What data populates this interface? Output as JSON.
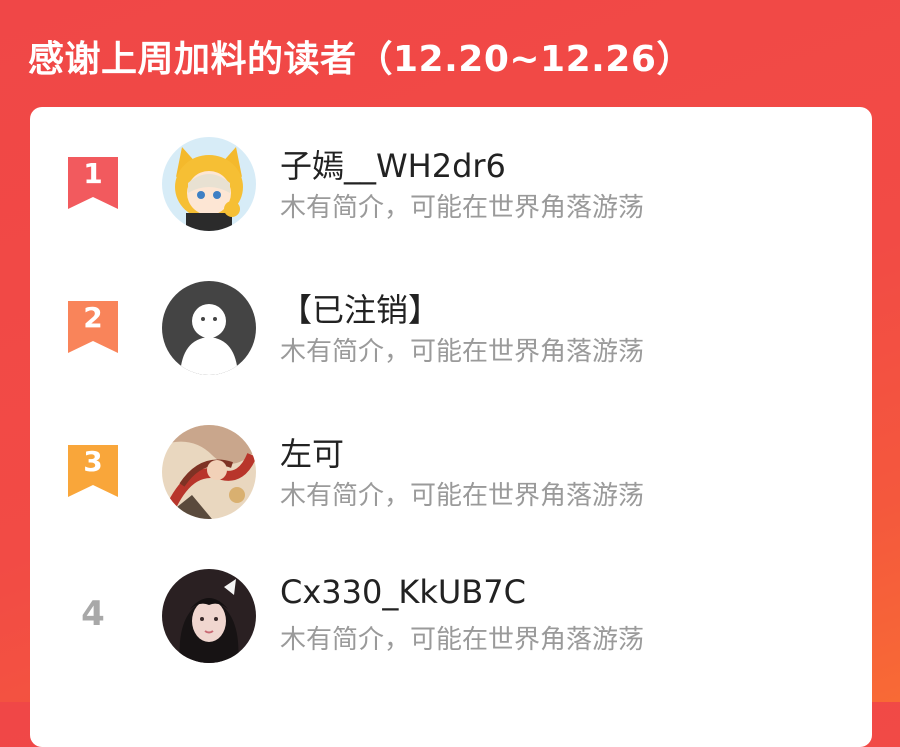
{
  "header": {
    "title": "感谢上周加料的读者（12.20~12.26）"
  },
  "readers": [
    {
      "rank": "1",
      "name": "子嫣__WH2dr6",
      "bio": "木有简介，可能在世界角落游荡",
      "badge_color": "#f25a5e",
      "avatar": "cartoon-cat-hood-girl"
    },
    {
      "rank": "2",
      "name": "【已注销】",
      "bio": "木有简介，可能在世界角落游荡",
      "badge_color": "#f9845a",
      "avatar": "default-ghost"
    },
    {
      "rank": "3",
      "name": "左可",
      "bio": "木有简介，可能在世界角落游荡",
      "badge_color": "#f9a63a",
      "avatar": "painting"
    },
    {
      "rank": "4",
      "name": "Cx330_KkUB7C",
      "bio": "木有简介，可能在世界角落游荡",
      "badge_color": "",
      "avatar": "photo-girl"
    }
  ]
}
